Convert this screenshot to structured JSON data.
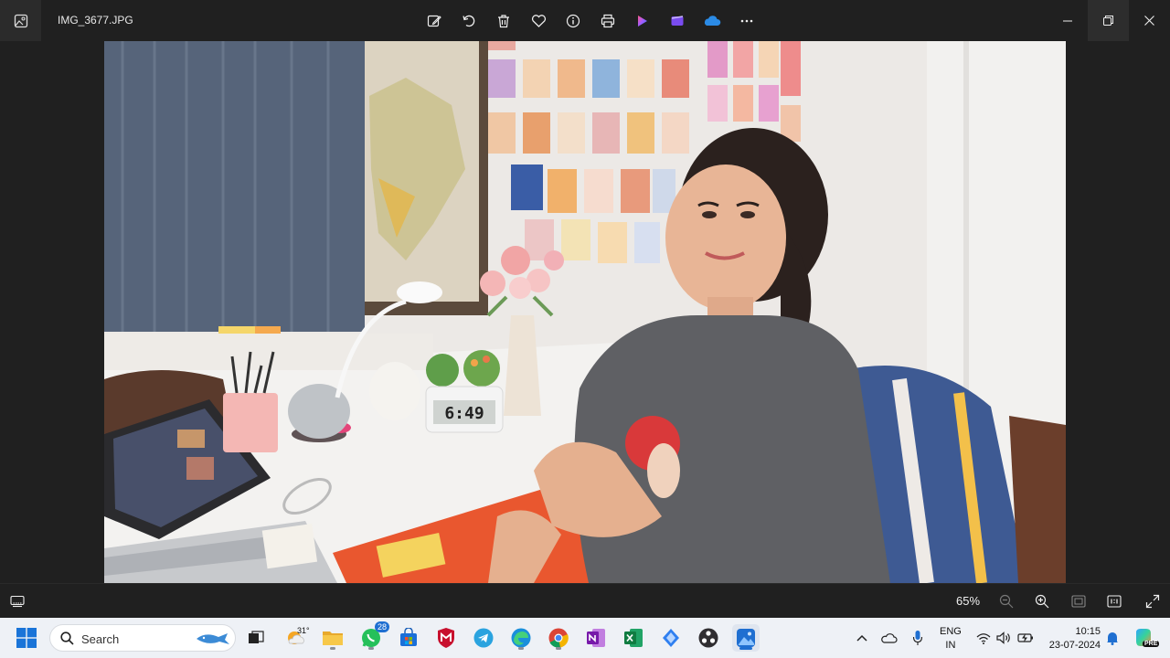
{
  "window": {
    "file_name": "IMG_3677.JPG",
    "toolbar": [
      "edit-icon",
      "rotate-icon",
      "delete-icon",
      "favorite-icon",
      "info-icon",
      "print-icon",
      "designer-icon",
      "clipchamp-icon",
      "onedrive-icon",
      "more-icon"
    ],
    "controls": [
      "minimize-icon",
      "restore-icon",
      "close-icon"
    ]
  },
  "viewer": {
    "zoom_label": "65%"
  },
  "photo": {
    "clock_display": "6:49"
  },
  "taskbar": {
    "search_placeholder": "Search",
    "weather_temp": "31°",
    "whatsapp_badge": "28",
    "language": "ENG",
    "region": "IN",
    "time": "10:15",
    "date": "23-07-2024",
    "copilot_label": "PRE"
  },
  "colors": {
    "accent": "#1f6fd1",
    "titlebar": "#202020"
  }
}
